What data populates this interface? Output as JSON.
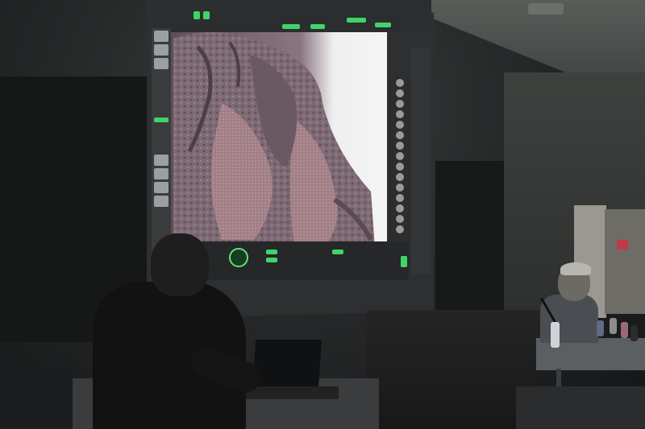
{
  "colors": {
    "accent_green": "#3fd46a",
    "wall": "#2e302f",
    "screen_frame": "#2e2f30"
  },
  "icons": [
    "sculpt-preview",
    "green-ring-icon"
  ]
}
